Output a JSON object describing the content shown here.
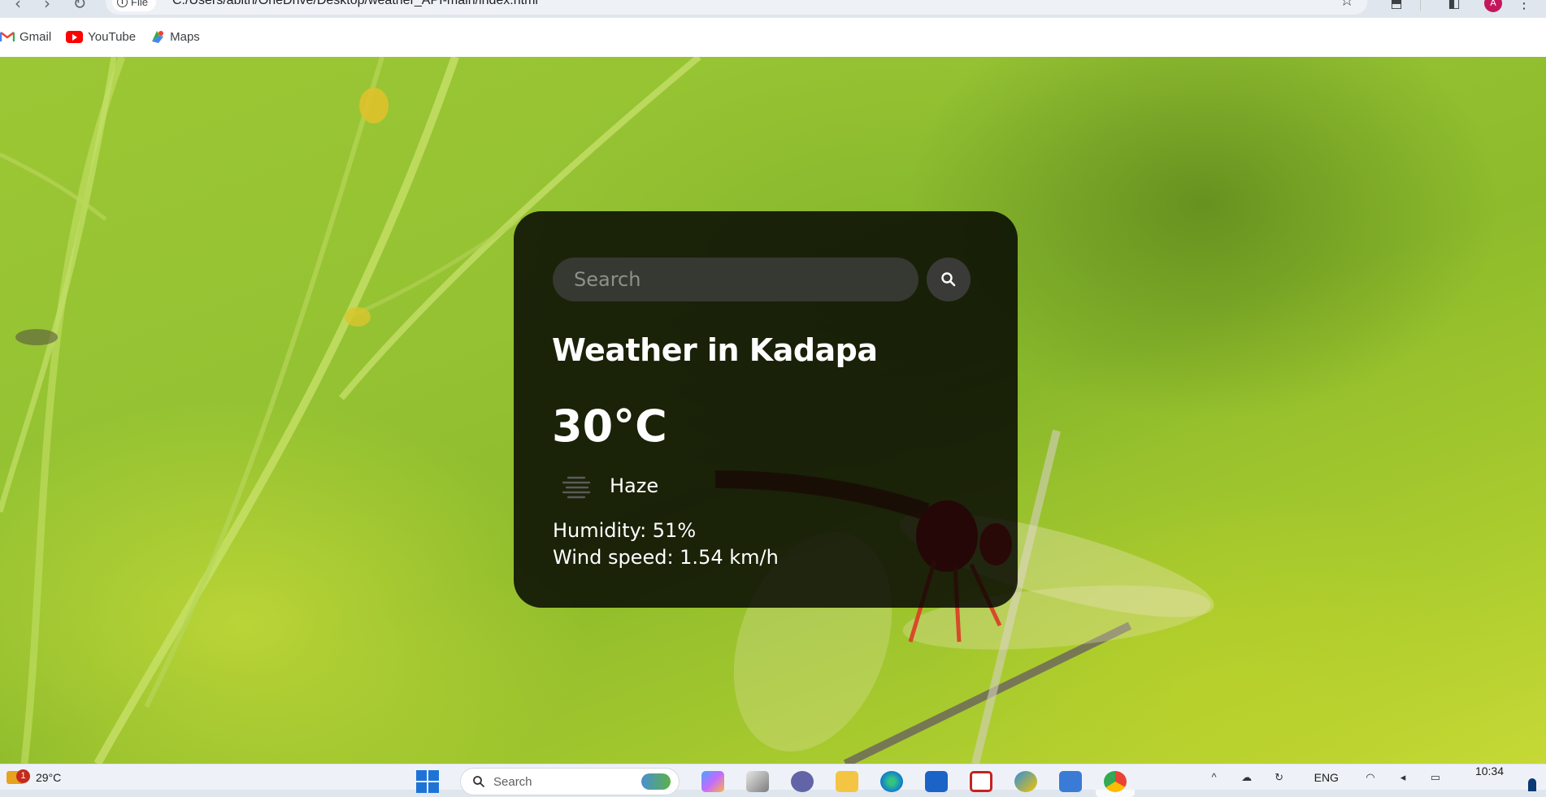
{
  "browser": {
    "site_chip": "File",
    "url": "C:/Users/abith/OneDrive/Desktop/weather_API-main/index.html",
    "bookmarks": [
      {
        "label": "Gmail",
        "icon": "gmail-icon"
      },
      {
        "label": "YouTube",
        "icon": "youtube-icon"
      },
      {
        "label": "Maps",
        "icon": "maps-icon"
      }
    ],
    "avatar_initial": "A"
  },
  "weather_card": {
    "search_placeholder": "Search",
    "title": "Weather in Kadapa",
    "temperature": "30°C",
    "description": "Haze",
    "humidity": "Humidity: 51%",
    "wind": "Wind speed: 1.54 km/h",
    "background_color": "#000000",
    "text_color": "#ffffff"
  },
  "taskbar": {
    "widget_badge": "1",
    "widget_temp": "29°C",
    "search_label": "Search",
    "language": "ENG",
    "clock": "10:34"
  }
}
